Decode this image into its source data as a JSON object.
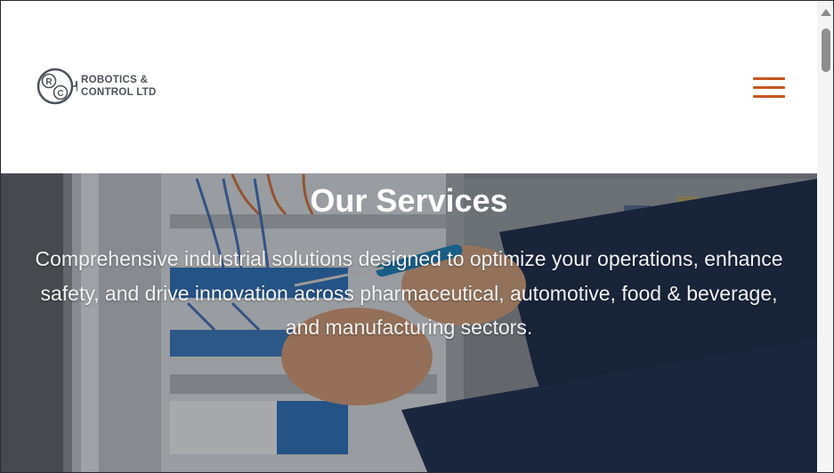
{
  "brand": {
    "line1": "ROBOTICS &",
    "line2": "CONTROL LTD",
    "mark_left": "R",
    "mark_right": "C"
  },
  "header": {
    "menu_icon": "hamburger-menu-icon",
    "accent_color": "#c9531e"
  },
  "hero": {
    "title": "Our Services",
    "description": "Comprehensive industrial solutions designed to optimize your operations, enhance safety, and drive innovation across pharmaceutical, automotive, food & beverage, and manufacturing sectors."
  }
}
